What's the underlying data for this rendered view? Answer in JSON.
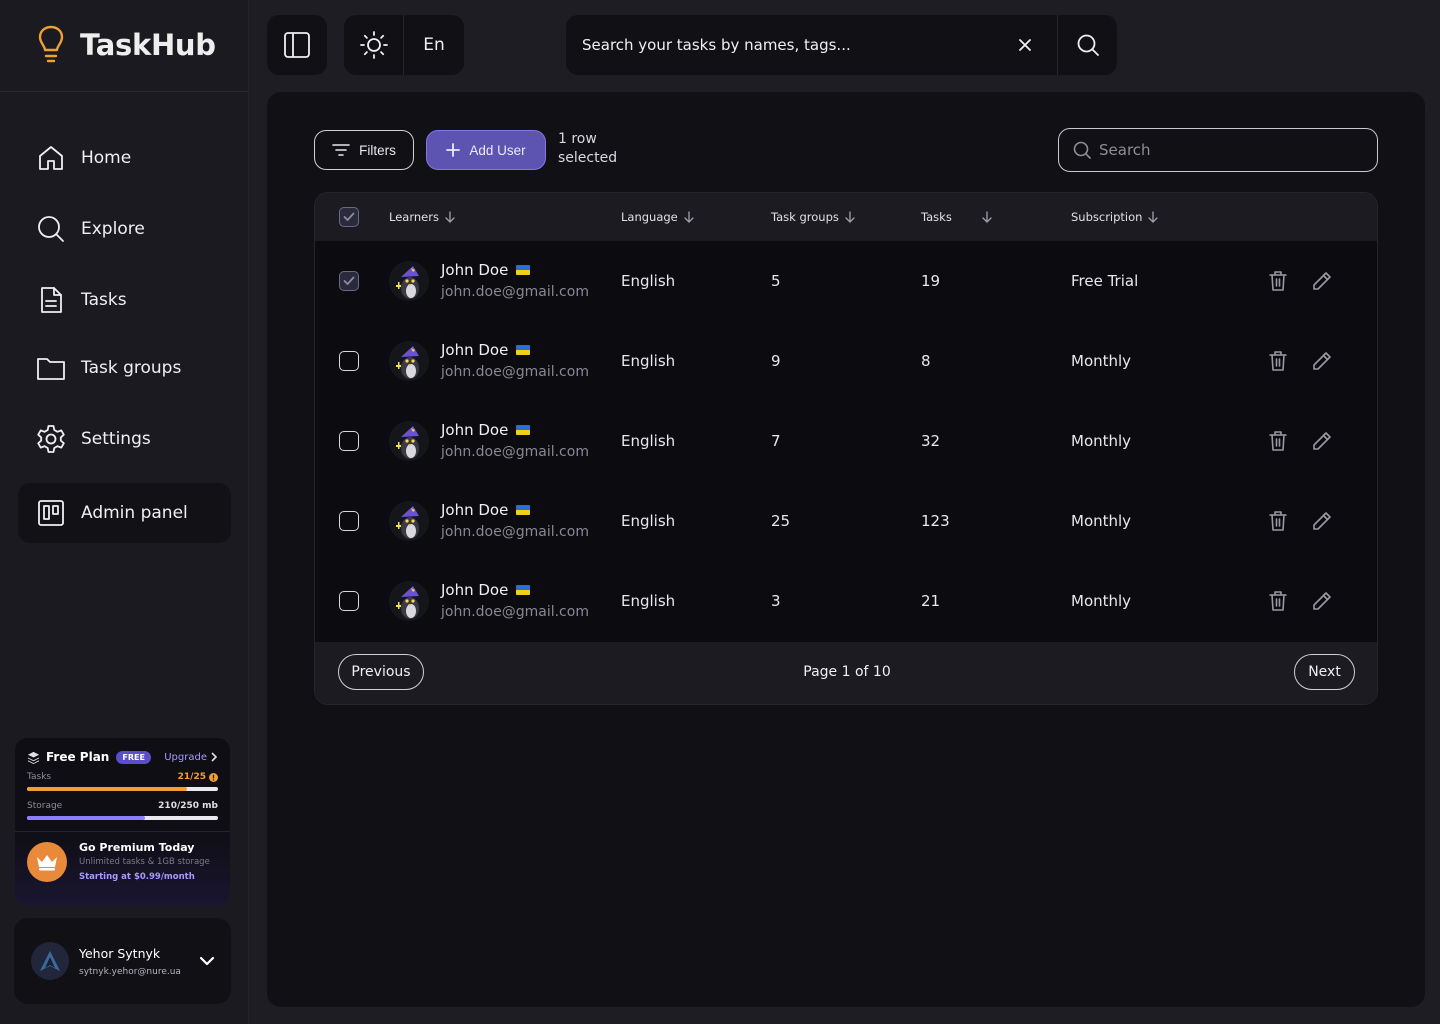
{
  "app": {
    "name": "TaskHub"
  },
  "sidebar": {
    "items": [
      {
        "label": "Home",
        "icon": "home-icon"
      },
      {
        "label": "Explore",
        "icon": "search-icon"
      },
      {
        "label": "Tasks",
        "icon": "document-icon"
      },
      {
        "label": "Task groups",
        "icon": "folder-icon"
      },
      {
        "label": "Settings",
        "icon": "gear-icon"
      },
      {
        "label": "Admin panel",
        "icon": "kanban-icon",
        "active": true
      }
    ],
    "plan": {
      "title": "Free Plan",
      "badge": "FREE",
      "upgrade_label": "Upgrade",
      "tasks_label": "Tasks",
      "tasks_value": "21/25",
      "tasks_fraction": 0.84,
      "storage_label": "Storage",
      "storage_value": "210/250 mb",
      "storage_fraction": 0.62,
      "premium_title": "Go Premium Today",
      "premium_sub": "Unlimited tasks & 1GB storage",
      "premium_price": "Starting at $0.99/month"
    },
    "user": {
      "name": "Yehor Sytnyk",
      "email": "sytnyk.yehor@nure.ua"
    }
  },
  "topbar": {
    "language": "En",
    "search_placeholder": "Search your tasks by names, tags..."
  },
  "main": {
    "filters_label": "Filters",
    "add_user_label": "Add User",
    "selection_text": "1 row selected",
    "search_placeholder": "Search",
    "columns": [
      "Learners",
      "Language",
      "Task groups",
      "Tasks",
      "Subscription"
    ],
    "rows": [
      {
        "name": "John Doe",
        "email": "john.doe@gmail.com",
        "language": "English",
        "task_groups": "5",
        "tasks": "19",
        "subscription": "Free Trial",
        "checked": true
      },
      {
        "name": "John Doe",
        "email": "john.doe@gmail.com",
        "language": "English",
        "task_groups": "9",
        "tasks": "8",
        "subscription": "Monthly",
        "checked": false
      },
      {
        "name": "John Doe",
        "email": "john.doe@gmail.com",
        "language": "English",
        "task_groups": "7",
        "tasks": "32",
        "subscription": "Monthly",
        "checked": false
      },
      {
        "name": "John Doe",
        "email": "john.doe@gmail.com",
        "language": "English",
        "task_groups": "25",
        "tasks": "123",
        "subscription": "Monthly",
        "checked": false
      },
      {
        "name": "John Doe",
        "email": "john.doe@gmail.com",
        "language": "English",
        "task_groups": "3",
        "tasks": "21",
        "subscription": "Monthly",
        "checked": false
      }
    ],
    "pagination": {
      "previous_label": "Previous",
      "page_text": "Page 1 of 10",
      "next_label": "Next"
    }
  },
  "colors": {
    "accent": "#5d53b0",
    "accent_light": "#a49bff",
    "warning": "#f0a030",
    "logo": "#f0a030"
  }
}
